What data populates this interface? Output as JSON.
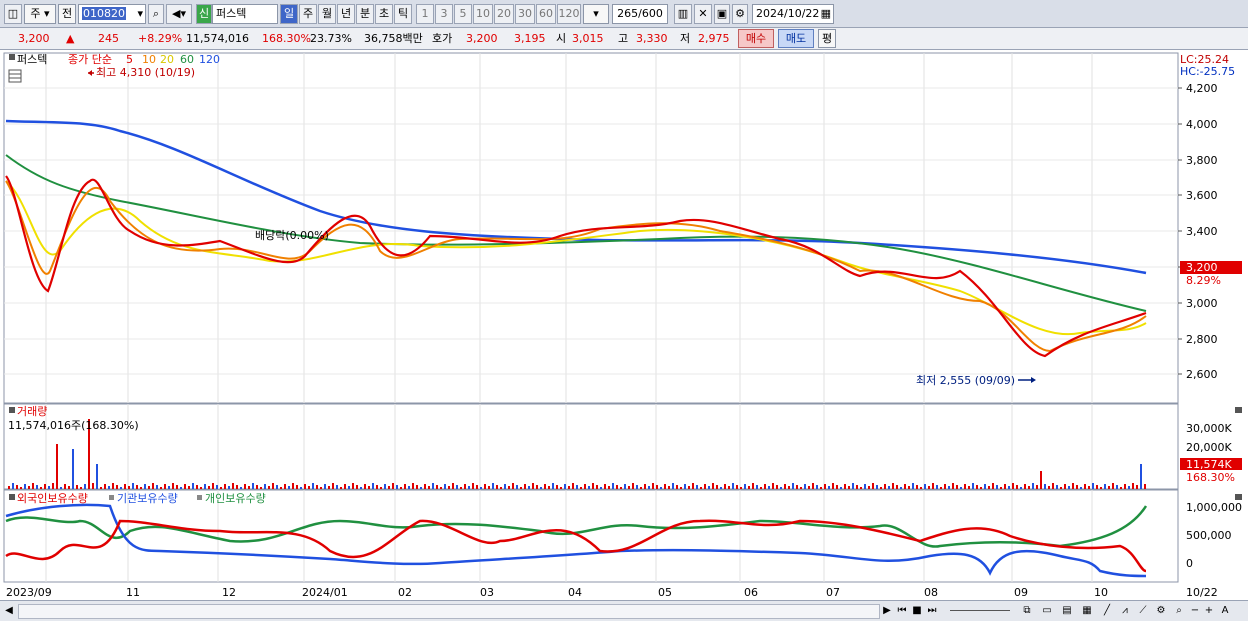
{
  "toolbar": {
    "market_label": "주",
    "prev_label": "전",
    "code": "010820",
    "credit_badge": "신",
    "stock_name": "퍼스텍",
    "periods": [
      "일",
      "주",
      "월",
      "년",
      "분",
      "초",
      "틱"
    ],
    "active_period": "일",
    "intervals": [
      "1",
      "3",
      "5",
      "10",
      "20",
      "30",
      "60",
      "120"
    ],
    "count": "265",
    "total": "/600",
    "date": "2024/10/22"
  },
  "quote": {
    "price": "3,200",
    "change_arrow": "▲",
    "change": "245",
    "change_pct": "+8.29%",
    "volume": "11,574,016",
    "volume_ratio": "168.30%",
    "turnover": "23.73%",
    "amount": "36,758백만",
    "bid_label": "호가",
    "ask": "3,200",
    "bid": "3,195",
    "open_label": "시",
    "open": "3,015",
    "high_label": "고",
    "high": "3,330",
    "low_label": "저",
    "low": "2,975",
    "buy_label": "매수",
    "sell_label": "매도",
    "extra_label": "평"
  },
  "price_panel": {
    "name": "퍼스텍",
    "legend_title": "종가 단순",
    "ma_periods": [
      "5",
      "10",
      "20",
      "60",
      "120"
    ],
    "ma_colors": [
      "#e00000",
      "#f08000",
      "#f0e000",
      "#209040",
      "#2050e0"
    ],
    "high_annotation": "최고 4,310 (10/19)",
    "low_annotation": "최저 2,555 (09/09)",
    "dividend_label": "배당락(0.00%)",
    "lc": "LC:25.24",
    "hc": "HC:-25.75",
    "y_ticks": [
      "4,200",
      "4,000",
      "3,800",
      "3,600",
      "3,400",
      "3,200",
      "3,000",
      "2,800",
      "2,600"
    ],
    "current_price_tag": "3,200",
    "current_pct_tag": "8.29%"
  },
  "volume_panel": {
    "title": "거래량",
    "info": "11,574,016주(168.30%)",
    "y_ticks": [
      "30,000K",
      "20,000K",
      "10,000K"
    ],
    "current_tag": "11,574K",
    "current_pct_tag": "168.30%"
  },
  "holding_panel": {
    "legend": [
      "외국인보유수량",
      "기관보유수량",
      "개인보유수량"
    ],
    "colors": [
      "#e00000",
      "#2050e0",
      "#209040"
    ],
    "y_ticks": [
      "1,000,000",
      "500,000",
      "0"
    ]
  },
  "x_axis": [
    "2023/09",
    "11",
    "12",
    "2024/01",
    "02",
    "03",
    "04",
    "05",
    "06",
    "07",
    "08",
    "09",
    "10",
    "10/22"
  ]
}
